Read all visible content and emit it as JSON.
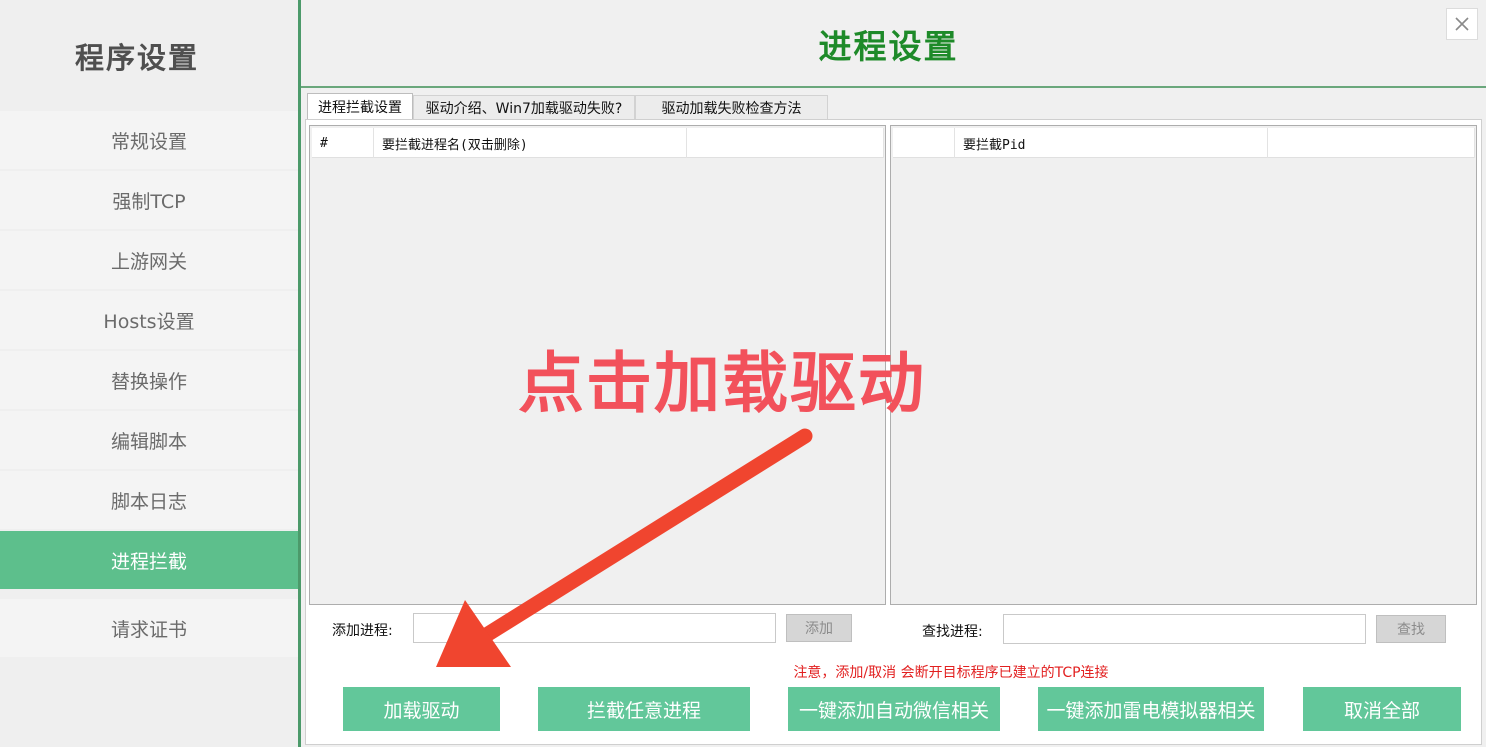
{
  "sidebar": {
    "title": "程序设置",
    "items": [
      {
        "label": "常规设置"
      },
      {
        "label": "强制TCP"
      },
      {
        "label": "上游网关"
      },
      {
        "label": "Hosts设置"
      },
      {
        "label": "替换操作"
      },
      {
        "label": "编辑脚本"
      },
      {
        "label": "脚本日志"
      },
      {
        "label": "进程拦截"
      },
      {
        "label": "请求证书"
      }
    ],
    "active_index": 7
  },
  "header": {
    "title": "进程设置"
  },
  "tabs": [
    {
      "label": "进程拦截设置",
      "active": true
    },
    {
      "label": "驱动介绍、Win7加载驱动失败?",
      "active": false
    },
    {
      "label": "驱动加载失败检查方法",
      "active": false
    }
  ],
  "process_list": {
    "columns": [
      "#",
      "要拦截进程名(双击删除)"
    ]
  },
  "pid_list": {
    "columns": [
      "要拦截Pid"
    ]
  },
  "add_process": {
    "label": "添加进程:",
    "value": "",
    "button_label": "添加"
  },
  "find_process": {
    "label": "查找进程:",
    "value": "",
    "button_label": "查找"
  },
  "warning_text": "注意，添加/取消 会断开目标程序已建立的TCP连接",
  "actions": {
    "load_driver": "加载驱动",
    "intercept_any": "拦截任意进程",
    "add_wechat": "一键添加自动微信相关",
    "add_leidian": "一键添加雷电模拟器相关",
    "cancel_all": "取消全部"
  },
  "annotation": {
    "text": "点击加载驱动",
    "color": "#f2515b",
    "arrow_color": "#f0452f"
  },
  "colors": {
    "accent_green": "#5dbf8c",
    "button_green": "#62c79a",
    "title_green": "#1e8a29",
    "warning_red": "#e22020"
  }
}
